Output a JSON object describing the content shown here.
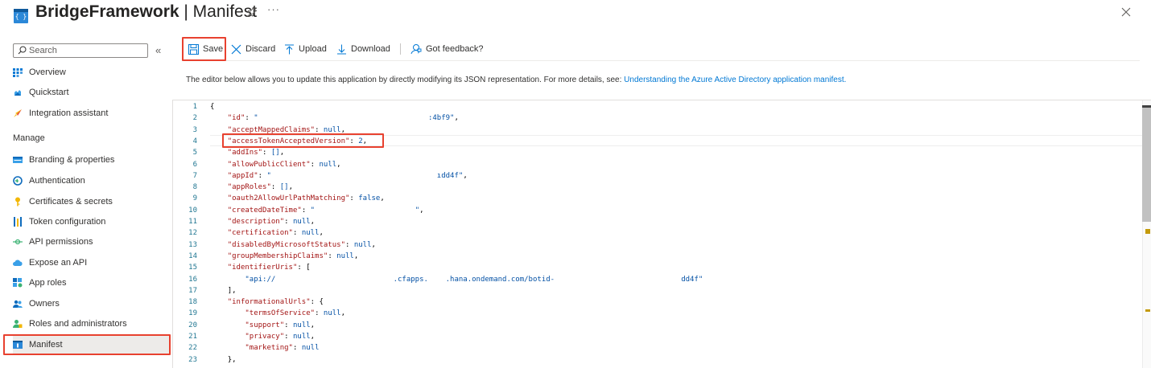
{
  "header": {
    "app_icon_text": "{ }",
    "title_bold": "BridgeFramework",
    "title_rest": " | Manifest",
    "more": "···"
  },
  "sidebar": {
    "search_placeholder": "Search",
    "collapse": "«",
    "items_top": [
      {
        "label": "Overview",
        "icon": "grid-icon"
      },
      {
        "label": "Quickstart",
        "icon": "cloud-icon"
      },
      {
        "label": "Integration assistant",
        "icon": "rocket-icon"
      }
    ],
    "section_label": "Manage",
    "items_manage": [
      {
        "label": "Branding & properties",
        "icon": "branding-icon"
      },
      {
        "label": "Authentication",
        "icon": "authentication-icon"
      },
      {
        "label": "Certificates & secrets",
        "icon": "key-icon"
      },
      {
        "label": "Token configuration",
        "icon": "token-icon"
      },
      {
        "label": "API permissions",
        "icon": "permissions-icon"
      },
      {
        "label": "Expose an API",
        "icon": "cloud-api-icon"
      },
      {
        "label": "App roles",
        "icon": "app-roles-icon"
      },
      {
        "label": "Owners",
        "icon": "owners-icon"
      },
      {
        "label": "Roles and administrators",
        "icon": "roles-icon"
      },
      {
        "label": "Manifest",
        "icon": "manifest-icon",
        "selected": true
      }
    ]
  },
  "toolbar": {
    "save": "Save",
    "discard": "Discard",
    "upload": "Upload",
    "download": "Download",
    "feedback": "Got feedback?"
  },
  "description": {
    "text": "The editor below allows you to update this application by directly modifying its JSON representation. For more details, see: ",
    "link": "Understanding the Azure Active Directory application manifest."
  },
  "editor": {
    "line_numbers": [
      "1",
      "2",
      "3",
      "4",
      "5",
      "6",
      "7",
      "8",
      "9",
      "10",
      "11",
      "12",
      "13",
      "14",
      "15",
      "16",
      "17",
      "18",
      "19",
      "20",
      "21",
      "22",
      "23"
    ],
    "lines": [
      {
        "indent": "",
        "key": "",
        "punct": "{",
        "value": "",
        "tail": ""
      },
      {
        "indent": "    ",
        "key": "\"id\"",
        "punct": ": ",
        "value": "\"                                       :4bf9\"",
        "tail": ","
      },
      {
        "indent": "    ",
        "key": "\"acceptMappedClaims\"",
        "punct": ": ",
        "value": "null",
        "tail": ","
      },
      {
        "indent": "    ",
        "key": "\"accessTokenAcceptedVersion\"",
        "punct": ": ",
        "value": "2",
        "tail": ","
      },
      {
        "indent": "    ",
        "key": "\"addIns\"",
        "punct": ": ",
        "value": "[]",
        "tail": ","
      },
      {
        "indent": "    ",
        "key": "\"allowPublicClient\"",
        "punct": ": ",
        "value": "null",
        "tail": ","
      },
      {
        "indent": "    ",
        "key": "\"appId\"",
        "punct": ": ",
        "value": "\"                                      ıdd4f\"",
        "tail": ","
      },
      {
        "indent": "    ",
        "key": "\"appRoles\"",
        "punct": ": ",
        "value": "[]",
        "tail": ","
      },
      {
        "indent": "    ",
        "key": "\"oauth2AllowUrlPathMatching\"",
        "punct": ": ",
        "value": "false",
        "tail": ","
      },
      {
        "indent": "    ",
        "key": "\"createdDateTime\"",
        "punct": ": ",
        "value": "\"                       \"",
        "tail": ","
      },
      {
        "indent": "    ",
        "key": "\"description\"",
        "punct": ": ",
        "value": "null",
        "tail": ","
      },
      {
        "indent": "    ",
        "key": "\"certification\"",
        "punct": ": ",
        "value": "null",
        "tail": ","
      },
      {
        "indent": "    ",
        "key": "\"disabledByMicrosoftStatus\"",
        "punct": ": ",
        "value": "null",
        "tail": ","
      },
      {
        "indent": "    ",
        "key": "\"groupMembershipClaims\"",
        "punct": ": ",
        "value": "null",
        "tail": ","
      },
      {
        "indent": "    ",
        "key": "\"identifierUris\"",
        "punct": ": ",
        "value": "",
        "tail": "["
      },
      {
        "indent": "        ",
        "key": "",
        "punct": "",
        "value": "\"api://                           .cfapps.    .hana.ondemand.com/botid-                             dd4f\"",
        "tail": ""
      },
      {
        "indent": "    ",
        "key": "",
        "punct": "",
        "value": "",
        "tail": "],"
      },
      {
        "indent": "    ",
        "key": "\"informationalUrls\"",
        "punct": ": ",
        "value": "",
        "tail": "{"
      },
      {
        "indent": "        ",
        "key": "\"termsOfService\"",
        "punct": ": ",
        "value": "null",
        "tail": ","
      },
      {
        "indent": "        ",
        "key": "\"support\"",
        "punct": ": ",
        "value": "null",
        "tail": ","
      },
      {
        "indent": "        ",
        "key": "\"privacy\"",
        "punct": ": ",
        "value": "null",
        "tail": ","
      },
      {
        "indent": "        ",
        "key": "\"marketing\"",
        "punct": ": ",
        "value": "null",
        "tail": ""
      },
      {
        "indent": "    ",
        "key": "",
        "punct": "",
        "value": "",
        "tail": "},"
      }
    ]
  },
  "colors": {
    "accent": "#0078d4",
    "highlight": "#e8412f",
    "json_key": "#a31515",
    "json_value": "#0451a5",
    "line_number": "#237893"
  }
}
